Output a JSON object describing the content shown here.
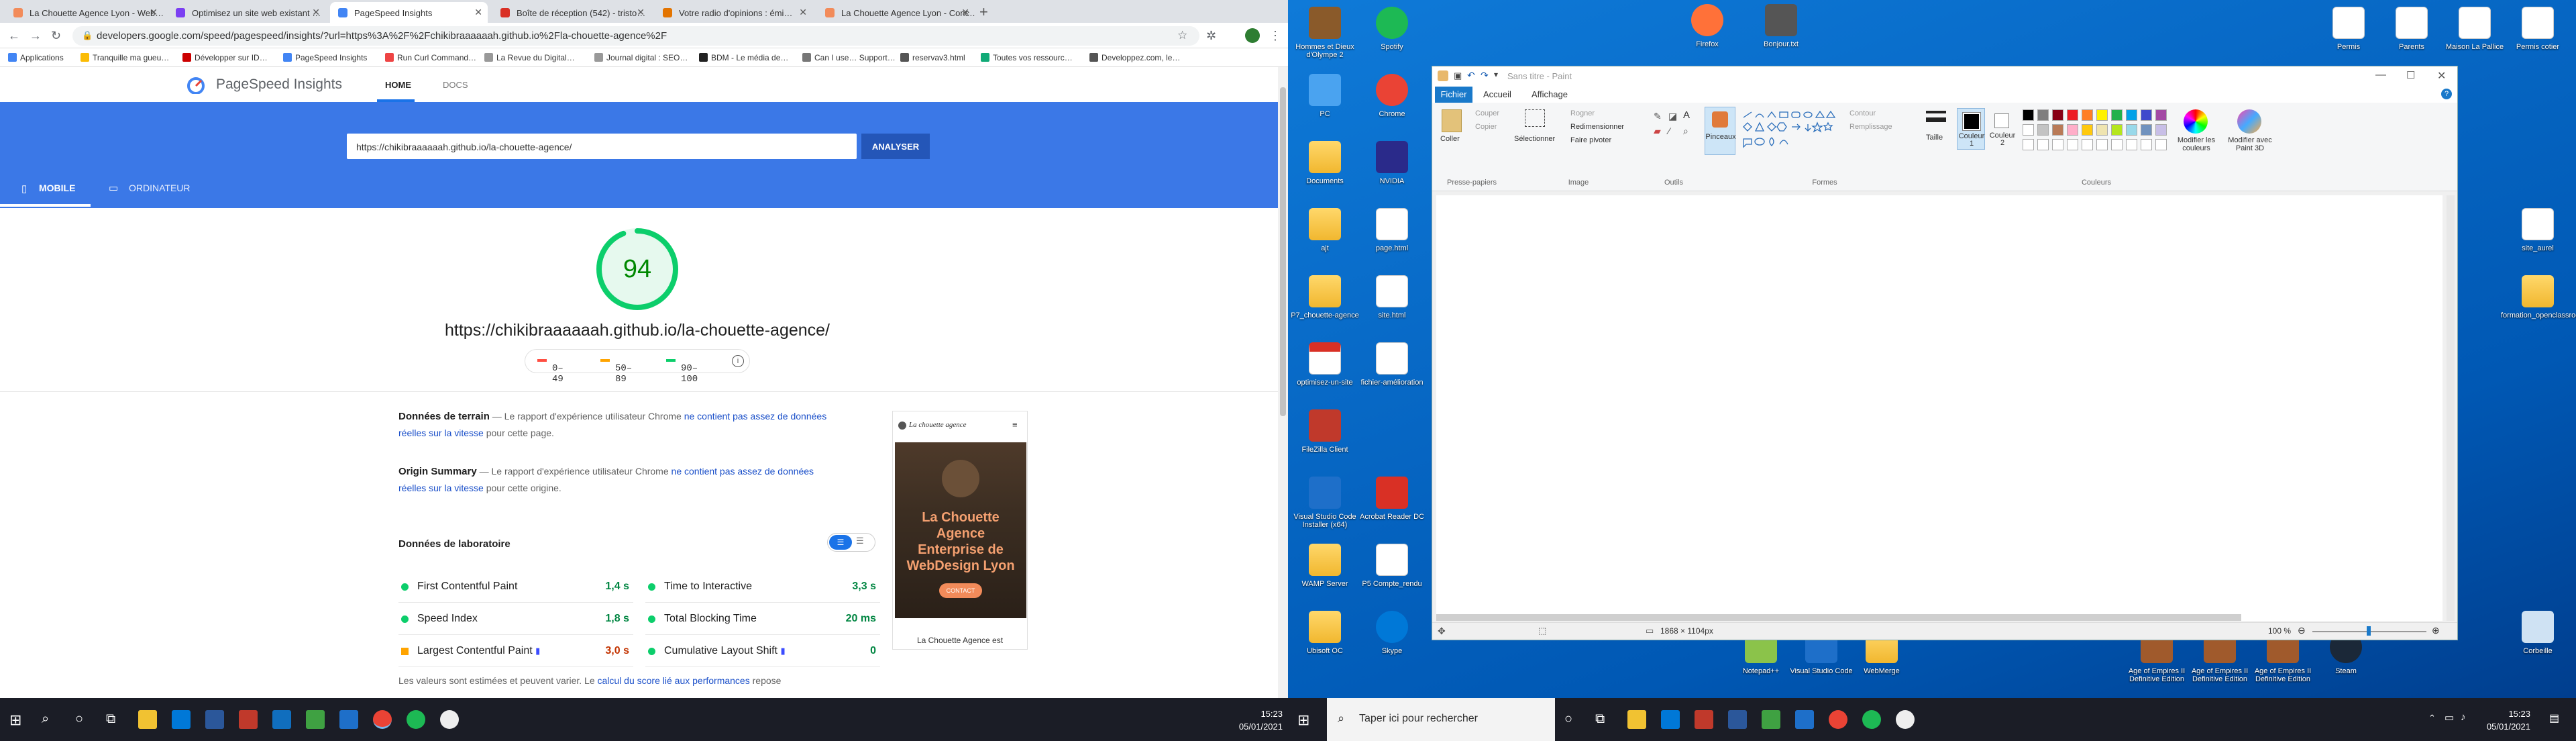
{
  "browser": {
    "tabs": [
      {
        "title": "La Chouette Agence Lyon - Web…",
        "color": "#f28b5a"
      },
      {
        "title": "Optimisez un site web existant …",
        "color": "#7b3ff2"
      },
      {
        "title": "PageSpeed Insights",
        "color": "#4285f4"
      },
      {
        "title": "Boîte de réception (542) - tristo…",
        "color": "#d93025"
      },
      {
        "title": "Votre radio d'opinions : émi…",
        "color": "#e37400"
      },
      {
        "title": "La Chouette Agence Lyon - Conc…",
        "color": "#f28b5a"
      }
    ],
    "new_tab": "+",
    "url": "developers.google.com/speed/pagespeed/insights/?url=https%3A%2F%2Fchikibraaaaaah.github.io%2Fla-chouette-agence%2F",
    "bookmarks": [
      {
        "label": "Applications",
        "color": "#4285f4"
      },
      {
        "label": "Tranquille ma gueu…",
        "color": "#fbbc05"
      },
      {
        "label": "Développer sur ID…",
        "color": "#c00"
      },
      {
        "label": "PageSpeed Insights",
        "color": "#4285f4"
      },
      {
        "label": "Run Curl Command…",
        "color": "#e44"
      },
      {
        "label": "La Revue du Digital…",
        "color": "#999"
      },
      {
        "label": "Journal digital : SEO…",
        "color": "#999"
      },
      {
        "label": "BDM - Le média de…",
        "color": "#222"
      },
      {
        "label": "Can I use… Support…",
        "color": "#777"
      },
      {
        "label": "reservav3.html",
        "color": "#555"
      },
      {
        "label": "Toutes vos ressourc…",
        "color": "#1a7"
      },
      {
        "label": "Developpez.com, le…",
        "color": "#555"
      }
    ]
  },
  "psi": {
    "brand": "PageSpeed Insights",
    "nav_home": "HOME",
    "nav_docs": "DOCS",
    "input_value": "https://chikibraaaaaah.github.io/la-chouette-agence/",
    "analyze": "ANALYSER",
    "tab_mobile": "MOBILE",
    "tab_desktop": "ORDINATEUR",
    "score": 94,
    "score_color": "#0cce6b",
    "tested_url": "https://chikibraaaaaah.github.io/la-chouette-agence/",
    "legend": [
      {
        "range": "0–49",
        "color": "#ff4e42"
      },
      {
        "range": "50–89",
        "color": "#ffa400"
      },
      {
        "range": "90–100",
        "color": "#0cce6b"
      }
    ],
    "field_title": "Données de terrain",
    "field_text_1": " — Le rapport d'expérience utilisateur Chrome ",
    "field_link_a": "ne contient pas assez de données",
    "field_link_b": "réelles sur la vitesse",
    "field_text_2": " pour cette page.",
    "origin_title": "Origin Summary",
    "origin_text_1": " — Le rapport d'expérience utilisateur Chrome ",
    "origin_link_a": "ne contient pas assez de données",
    "origin_link_b": "réelles sur la vitesse",
    "origin_text_2": " pour cette origine.",
    "lab_title": "Données de laboratoire",
    "metrics_left": [
      {
        "label": "First Contentful Paint",
        "value": "1,4 s",
        "status": "good"
      },
      {
        "label": "Speed Index",
        "value": "1,8 s",
        "status": "good"
      },
      {
        "label": "Largest Contentful Paint",
        "value": "3,0 s",
        "status": "average"
      }
    ],
    "metrics_right": [
      {
        "label": "Time to Interactive",
        "value": "3,3 s",
        "status": "good"
      },
      {
        "label": "Total Blocking Time",
        "value": "20 ms",
        "status": "good"
      },
      {
        "label": "Cumulative Layout Shift",
        "value": "0",
        "status": "good"
      }
    ],
    "footnote_1": "Les valeurs sont estimées et peuvent varier. Le ",
    "footnote_link": "calcul du score lié aux performances",
    "footnote_2": " repose",
    "thumb_site": "La chouette agence",
    "thumb_headline": "La Chouette Agence Enterprise de WebDesign Lyon",
    "thumb_button": "CONTACT",
    "thumb_caption": "La Chouette Agence est"
  },
  "taskbar_left": {
    "time": "15:23",
    "date": "05/01/2021"
  },
  "taskbar_right": {
    "search_placeholder": "Taper ici pour rechercher",
    "time": "15:23",
    "date": "05/01/2021"
  },
  "desktop_icons_left": [
    {
      "label": "Hommes et Dieux d'Olympe 2",
      "color": "#8a5a2a"
    },
    {
      "label": "Spotify",
      "color": "#1db954"
    },
    {
      "label": "PC",
      "color": "#4aa3f0"
    },
    {
      "label": "Chrome",
      "color": "#ea4335"
    },
    {
      "label": "Documents",
      "color": "#f1c232"
    },
    {
      "label": "NVIDIA",
      "color": "#2a2a8a"
    },
    {
      "label": "ajt",
      "color": "#f1c232"
    },
    {
      "label": "page.html",
      "color": "#ffffff"
    },
    {
      "label": "P7_chouette-agence",
      "color": "#f1c232"
    },
    {
      "label": "site.html",
      "color": "#ffffff"
    },
    {
      "label": "optimisez-un-site",
      "color": "#d93025"
    },
    {
      "label": "fichier-amélioration",
      "color": "#ffffff"
    },
    {
      "label": "FileZilla Client",
      "color": "#c0392b"
    },
    {
      "label": "Visual Studio Code Installer (x64)",
      "color": "#1e6fc9"
    },
    {
      "label": "Acrobat Reader DC",
      "color": "#d93025"
    },
    {
      "label": "WAMP Server",
      "color": "#f1c232"
    },
    {
      "label": "P5 Compte_rendu",
      "color": "#ffffff"
    },
    {
      "label": "Ubisoft OC",
      "color": "#f1c232"
    },
    {
      "label": "Skype",
      "color": "#0078d7"
    }
  ],
  "desktop_icons_top": [
    {
      "label": "Firefox",
      "color": "#ff7139"
    },
    {
      "label": "Bonjour.txt",
      "color": "#555555"
    }
  ],
  "desktop_icons_right": [
    {
      "label": "Permis",
      "color": "#ffffff"
    },
    {
      "label": "Parents",
      "color": "#ffffff"
    },
    {
      "label": "Maison La Pallice",
      "color": "#ffffff"
    },
    {
      "label": "Permis cotier",
      "color": "#ffffff"
    },
    {
      "label": "site_aurel",
      "color": "#ffffff"
    },
    {
      "label": "formation_openclassrooms",
      "color": "#f1c232"
    },
    {
      "label": "Corbeille",
      "color": "#cfe2f3"
    }
  ],
  "desktop_icons_bottom": [
    {
      "label": "Notepad++",
      "color": "#8bc34a"
    },
    {
      "label": "Visual Studio Code",
      "color": "#1e6fc9"
    },
    {
      "label": "WebMerge",
      "color": "#f1c232"
    },
    {
      "label": "Age of Empires II Definitive Edition",
      "color": "#a05a2c"
    },
    {
      "label": "Age of Empires II Definitive Edition",
      "color": "#a05a2c"
    },
    {
      "label": "Age of Empires II Definitive Edition",
      "color": "#a05a2c"
    },
    {
      "label": "Steam",
      "color": "#1b2838"
    }
  ],
  "paint": {
    "title": "Sans titre - Paint",
    "tab_file": "Fichier",
    "tab_home": "Accueil",
    "tab_view": "Affichage",
    "paste": "Coller",
    "cut": "Couper",
    "copy": "Copier",
    "select": "Sélectionner",
    "crop": "Rogner",
    "resize": "Redimensionner",
    "rotate": "Faire pivoter",
    "brushes": "Pinceaux",
    "outline": "Contour",
    "fill": "Remplissage",
    "size": "Taille",
    "color1": "Couleur 1",
    "color2": "Couleur 2",
    "edit_colors": "Modifier les couleurs",
    "paint3d": "Modifier avec Paint 3D",
    "grp_clipboard": "Presse-papiers",
    "grp_image": "Image",
    "grp_tools": "Outils",
    "grp_shapes": "Formes",
    "grp_colors": "Couleurs",
    "dims": "1868 × 1104px",
    "zoom": "100 %",
    "palette": [
      "#000000",
      "#7f7f7f",
      "#880015",
      "#ed1c24",
      "#ff7f27",
      "#fff200",
      "#22b14c",
      "#00a2e8",
      "#3f48cc",
      "#a349a4",
      "#ffffff",
      "#c3c3c3",
      "#b97a57",
      "#ffaec9",
      "#ffc90e",
      "#efe4b0",
      "#b5e61d",
      "#99d9ea",
      "#7092be",
      "#c8bfe7"
    ]
  }
}
